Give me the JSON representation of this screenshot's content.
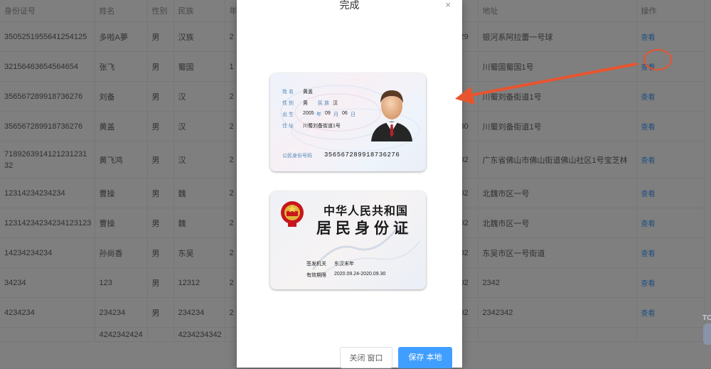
{
  "table": {
    "headers": [
      "身份证号",
      "姓名",
      "性别",
      "民族",
      "年",
      "",
      "地址",
      "操作"
    ],
    "rows": [
      {
        "id": "3505251955641254125",
        "name": "多啦A夢",
        "gender": "男",
        "ethnicity": "汉族",
        "year": "2",
        "date_tail": ".29",
        "address": "银河系阿拉蕾一号球",
        "action": "查看"
      },
      {
        "id": "32156463654564654",
        "name": "张飞",
        "gender": "男",
        "ethnicity": "蜀国",
        "year": "1",
        "date_tail": "",
        "address": "川蜀国蜀国1号",
        "action": "查看"
      },
      {
        "id": "356567289918736276",
        "name": "刘备",
        "gender": "男",
        "ethnicity": "汉",
        "year": "2",
        "date_tail": ".30",
        "address": "川蜀刘备街道1号",
        "action": "查看"
      },
      {
        "id": "356567289918736276",
        "name": "黄盖",
        "gender": "男",
        "ethnicity": "汉",
        "year": "2",
        "date_tail": ".30",
        "address": "川蜀刘备街道1号",
        "action": "查看"
      },
      {
        "id": "718926391412123123132",
        "name": "黄飞鸿",
        "gender": "男",
        "ethnicity": "汉",
        "year": "2",
        "date_tail": ".02",
        "address": "广东省佛山市佛山街道佛山社区1号宝芝林",
        "action": "查看"
      },
      {
        "id": "12314234234234",
        "name": "曹操",
        "gender": "男",
        "ethnicity": "魏",
        "year": "2",
        "date_tail": ".02",
        "address": "北魏市区一号",
        "action": "查看"
      },
      {
        "id": "12314234234234123123",
        "name": "曹操",
        "gender": "男",
        "ethnicity": "魏",
        "year": "2",
        "date_tail": ".02",
        "address": "北魏市区一号",
        "action": "查看"
      },
      {
        "id": "14234234234",
        "name": "孙尚香",
        "gender": "男",
        "ethnicity": "东吴",
        "year": "2",
        "date_tail": ".02",
        "address": "东吴市区一号街道",
        "action": "查看"
      },
      {
        "id": "34234",
        "name": "123",
        "gender": "男",
        "ethnicity": "12312",
        "year": "2",
        "date_tail": ".02",
        "address": "2342",
        "action": "查看"
      },
      {
        "id": "4234234",
        "name": "234234",
        "gender": "男",
        "ethnicity": "234234",
        "year": "2",
        "date_tail": ".02",
        "address": "2342342",
        "action": "查看"
      },
      {
        "id": "",
        "name": "4242342424",
        "gender": "",
        "ethnicity": "4234234342",
        "year": "",
        "date_tail": "",
        "address": "",
        "action": ""
      }
    ]
  },
  "side_widget": {
    "label": "TC"
  },
  "dialog": {
    "title": "完成",
    "close_symbol": "×",
    "front": {
      "name_label": "姓 名",
      "name_value": "黄盖",
      "gender_label": "性 别",
      "gender_value": "男",
      "ethnicity_label": "民 族",
      "ethnicity_value": "汉",
      "birth_label": "出 生",
      "birth_year": "2005",
      "year_unit": "年",
      "birth_month": "09",
      "month_unit": "月",
      "birth_day": "06",
      "day_unit": "日",
      "address_label": "住 址",
      "address_value": "川蜀刘备街道1号",
      "id_label": "公民身份号码",
      "id_value": "356567289918736276"
    },
    "back": {
      "country_title": "中华人民共和国",
      "card_name": "居民身份证",
      "authority_label": "签发机关",
      "authority_value": "东汉末年",
      "validity_label": "有效期限",
      "validity_value": "2020.09.24-2020.09.30"
    },
    "buttons": {
      "close": "关闭 窗口",
      "save": "保存 本地"
    }
  },
  "icons": {
    "portrait": "person-avatar-icon",
    "emblem": "national-emblem-icon",
    "robot": "robot-icon"
  },
  "colors": {
    "primary": "#409eff",
    "annotation": "#e8542e",
    "label_blue": "#4f88b8",
    "emblem_red": "#c8161d"
  }
}
